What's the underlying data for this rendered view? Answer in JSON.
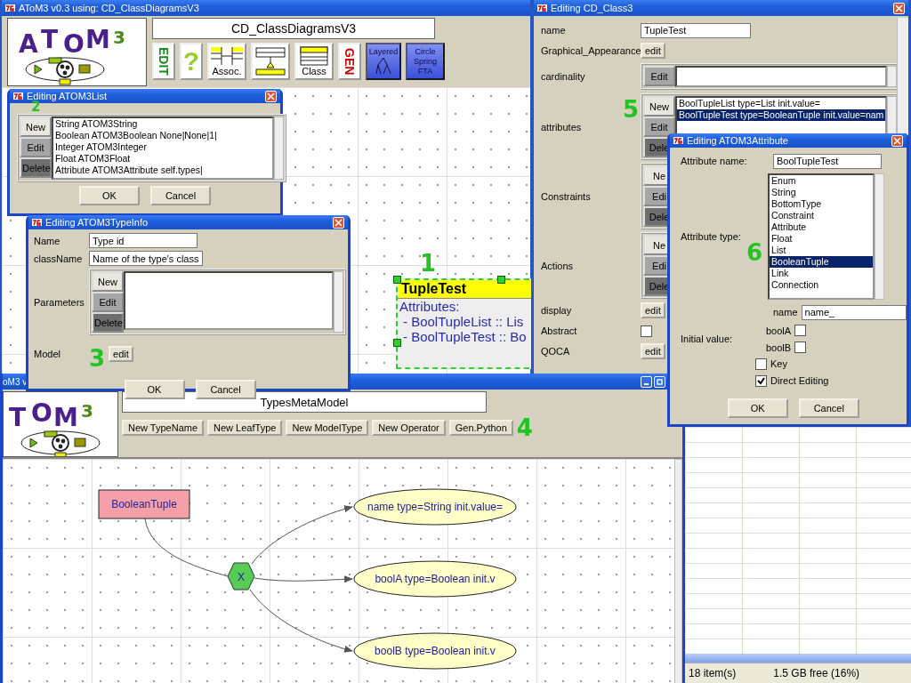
{
  "main_window": {
    "title": "AToM3 v0.3 using: CD_ClassDiagramsV3",
    "logo": "ATOM3",
    "model_name": "CD_ClassDiagramsV3",
    "toolbar": [
      {
        "kind": "edit",
        "label": "EDIT"
      },
      {
        "kind": "help",
        "label": "?"
      },
      {
        "kind": "assoc",
        "label": "Assoc."
      },
      {
        "kind": "inherit"
      },
      {
        "kind": "class",
        "label": "Class"
      },
      {
        "kind": "gen",
        "label": "GEN"
      },
      {
        "kind": "layered",
        "label": "Layered"
      },
      {
        "kind": "spring",
        "label": "Circle Spring FTA"
      }
    ],
    "class_node": {
      "name": "TupleTest",
      "lines": [
        "Attributes:",
        "- BoolTupleList :: Lis",
        "- BoolTupleTest :: Bo"
      ]
    },
    "marker": "1"
  },
  "class_dialog": {
    "title": "Editing CD_Class3",
    "marker": "5",
    "rows": [
      {
        "kind": "field",
        "label": "name",
        "value": "TupleTest"
      },
      {
        "kind": "button",
        "label": "Graphical_Appearance",
        "button": "edit"
      },
      {
        "kind": "list",
        "label": "cardinality",
        "buttons": [
          "Edit"
        ]
      },
      {
        "kind": "list",
        "label": "attributes",
        "buttons": [
          "New",
          "Edit",
          "Dele"
        ],
        "items": [
          {
            "text": "BoolTupleList type=List init.value=",
            "selected": false
          },
          {
            "text": "BoolTupleTest type=BooleanTuple init.value=nam",
            "selected": true
          }
        ]
      },
      {
        "kind": "list",
        "label": "Constraints",
        "buttons": [
          "Ne",
          "Edi",
          "Dele"
        ]
      },
      {
        "kind": "list",
        "label": "Actions",
        "buttons": [
          "Ne",
          "Edi",
          "Dele"
        ]
      },
      {
        "kind": "button",
        "label": "display",
        "button": "edit"
      },
      {
        "kind": "checkbox",
        "label": "Abstract",
        "checked": false
      },
      {
        "kind": "button",
        "label": "QOCA",
        "button": "edit"
      }
    ]
  },
  "explorer": {
    "status": [
      "18 item(s)",
      "1.5 GB free (16%)"
    ]
  },
  "types_window": {
    "title": "oM3 v",
    "logo": "TOM3",
    "model_name": "TypesMetaModel",
    "buttons": [
      "New TypeName",
      "New LeafType",
      "New ModelType",
      "New Operator",
      "Gen.Python"
    ],
    "marker": "4",
    "graph": {
      "entity": "BooleanTuple",
      "operator": "X",
      "attributes": [
        "name type=String init.value=",
        "boolA type=Boolean init.v",
        "boolB type=Boolean init.v"
      ]
    }
  },
  "list_dialog": {
    "title": "Editing ATOM3List",
    "marker": "2",
    "buttons": [
      "New",
      "Edit",
      "Delete"
    ],
    "items": [
      "String ATOM3String",
      "Boolean ATOM3Boolean None|None|1|",
      "Integer ATOM3Integer",
      "Float ATOM3Float",
      "Attribute ATOM3Attribute self.types|"
    ],
    "actions": [
      "OK",
      "Cancel"
    ]
  },
  "typeinfo_dialog": {
    "title": "Editing ATOM3TypeInfo",
    "marker": "3",
    "name_label": "Name",
    "name": "Type id",
    "classname_label": "className",
    "classname": "Name of the type's class",
    "parameters_label": "Parameters",
    "parameter_buttons": [
      "New",
      "Edit",
      "Delete"
    ],
    "model_label": "Model",
    "model_button": "edit",
    "actions": [
      "OK",
      "Cancel"
    ]
  },
  "attribute_dialog": {
    "title": "Editing ATOM3Attribute",
    "marker": "6",
    "name_label": "Attribute name:",
    "name": "BoolTupleTest",
    "type_label": "Attribute type:",
    "types": [
      {
        "label": "Enum",
        "selected": false
      },
      {
        "label": "String",
        "selected": false
      },
      {
        "label": "BottomType",
        "selected": false
      },
      {
        "label": "Constraint",
        "selected": false
      },
      {
        "label": "Attribute",
        "selected": false
      },
      {
        "label": "Float",
        "selected": false
      },
      {
        "label": "List",
        "selected": false
      },
      {
        "label": "BooleanTuple",
        "selected": true
      },
      {
        "label": "Link",
        "selected": false
      },
      {
        "label": "Connection",
        "selected": false
      }
    ],
    "field_label": "name",
    "field_value": "name_",
    "initial_label": "Initial value:",
    "initial": [
      {
        "label": "boolA",
        "checked": false
      },
      {
        "label": "boolB",
        "checked": false
      }
    ],
    "options": [
      {
        "label": "Key",
        "checked": false
      },
      {
        "label": "Direct Editing",
        "checked": true
      }
    ],
    "actions": [
      "OK",
      "Cancel"
    ]
  }
}
